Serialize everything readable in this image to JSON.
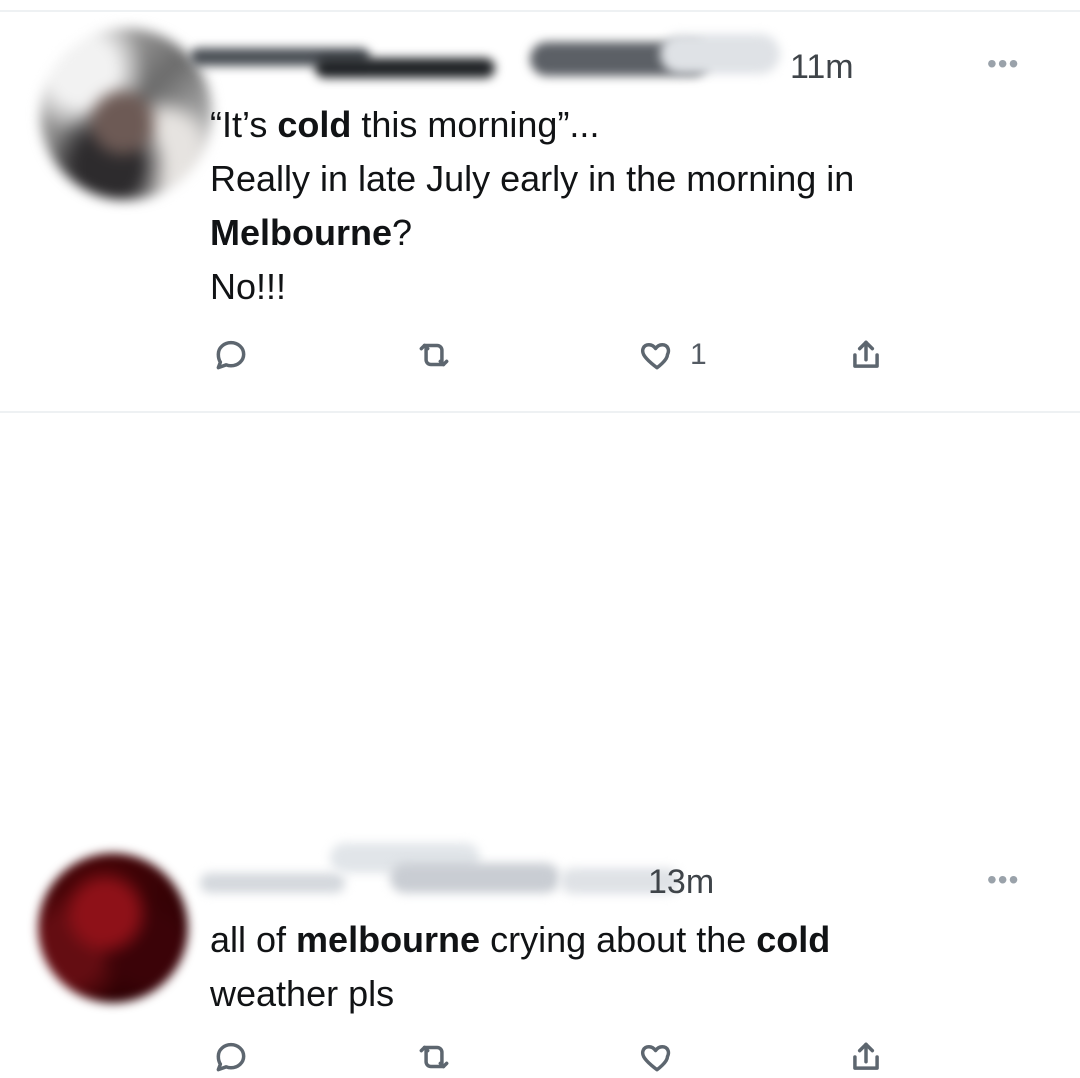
{
  "tweets": [
    {
      "time": "11m",
      "text": {
        "line1_prefix": "“It’s ",
        "line1_bold": "cold",
        "line1_suffix": " this morning”...",
        "line2": "Really in late July early in the morning in",
        "line3_bold": "Melbourne",
        "line3_suffix": "?",
        "line4": "No!!!"
      },
      "more": "•••",
      "actions": {
        "reply_count": "",
        "retweet_count": "",
        "like_count": "1",
        "share_count": ""
      }
    },
    {
      "time": "13m",
      "text": {
        "line1_prefix": "all of ",
        "line1_bold": "melbourne",
        "line1_middle": " crying about the ",
        "line1_bold_2": "cold",
        "line2": "weather pls"
      },
      "more": "•••",
      "actions": {
        "reply_count": "",
        "retweet_count": "",
        "like_count": "",
        "share_count": ""
      }
    }
  ],
  "icons": {
    "reply": "reply-icon",
    "retweet": "retweet-icon",
    "like": "heart-icon",
    "share": "share-icon",
    "more": "more-options-icon"
  },
  "colors": {
    "text": "#111315",
    "muted": "#5d666f",
    "divider": "#eef1f3"
  }
}
